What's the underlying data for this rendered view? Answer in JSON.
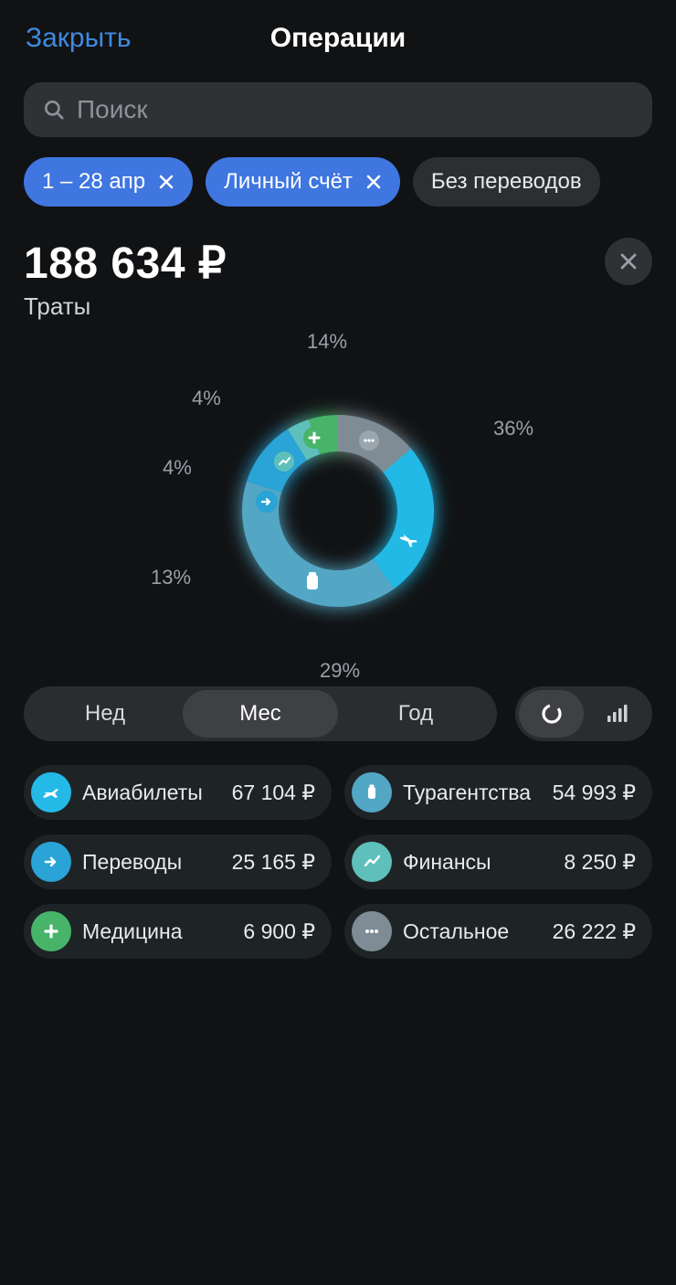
{
  "header": {
    "close": "Закрыть",
    "title": "Операции"
  },
  "search": {
    "placeholder": "Поиск"
  },
  "filters": {
    "period": "1 – 28 апр",
    "account": "Личный счёт",
    "exclude": "Без переводов"
  },
  "total": {
    "amount": "188 634 ₽",
    "label": "Траты"
  },
  "chart_data": {
    "type": "pie",
    "title": "Траты",
    "series": [
      {
        "name": "Авиабилеты",
        "pct": 36,
        "value": 67104,
        "color": "#24b9e6"
      },
      {
        "name": "Турагентства",
        "pct": 29,
        "value": 54993,
        "color": "#52a7c4"
      },
      {
        "name": "Переводы",
        "pct": 13,
        "value": 25165,
        "color": "#2aa3d6"
      },
      {
        "name": "Финансы",
        "pct": 4,
        "value": 8250,
        "color": "#5fc0bb"
      },
      {
        "name": "Медицина",
        "pct": 4,
        "value": 6900,
        "color": "#47b469"
      },
      {
        "name": "Остальное",
        "pct": 14,
        "value": 26222,
        "color": "#7f8c95"
      }
    ],
    "currency": "₽",
    "pct_labels": {
      "p36": "36%",
      "p29": "29%",
      "p13": "13%",
      "p4a": "4%",
      "p4b": "4%",
      "p14": "14%"
    }
  },
  "period_tabs": {
    "week": "Нед",
    "month": "Мес",
    "year": "Год",
    "active": "month"
  },
  "categories": [
    {
      "name": "Авиабилеты",
      "amount": "67 104 ₽",
      "icon": "plane"
    },
    {
      "name": "Турагентства",
      "amount": "54 993 ₽",
      "icon": "jar"
    },
    {
      "name": "Переводы",
      "amount": "25 165 ₽",
      "icon": "arrow"
    },
    {
      "name": "Финансы",
      "amount": "8 250 ₽",
      "icon": "chart"
    },
    {
      "name": "Медицина",
      "amount": "6 900 ₽",
      "icon": "plus"
    },
    {
      "name": "Остальное",
      "amount": "26 222 ₽",
      "icon": "dots"
    }
  ]
}
